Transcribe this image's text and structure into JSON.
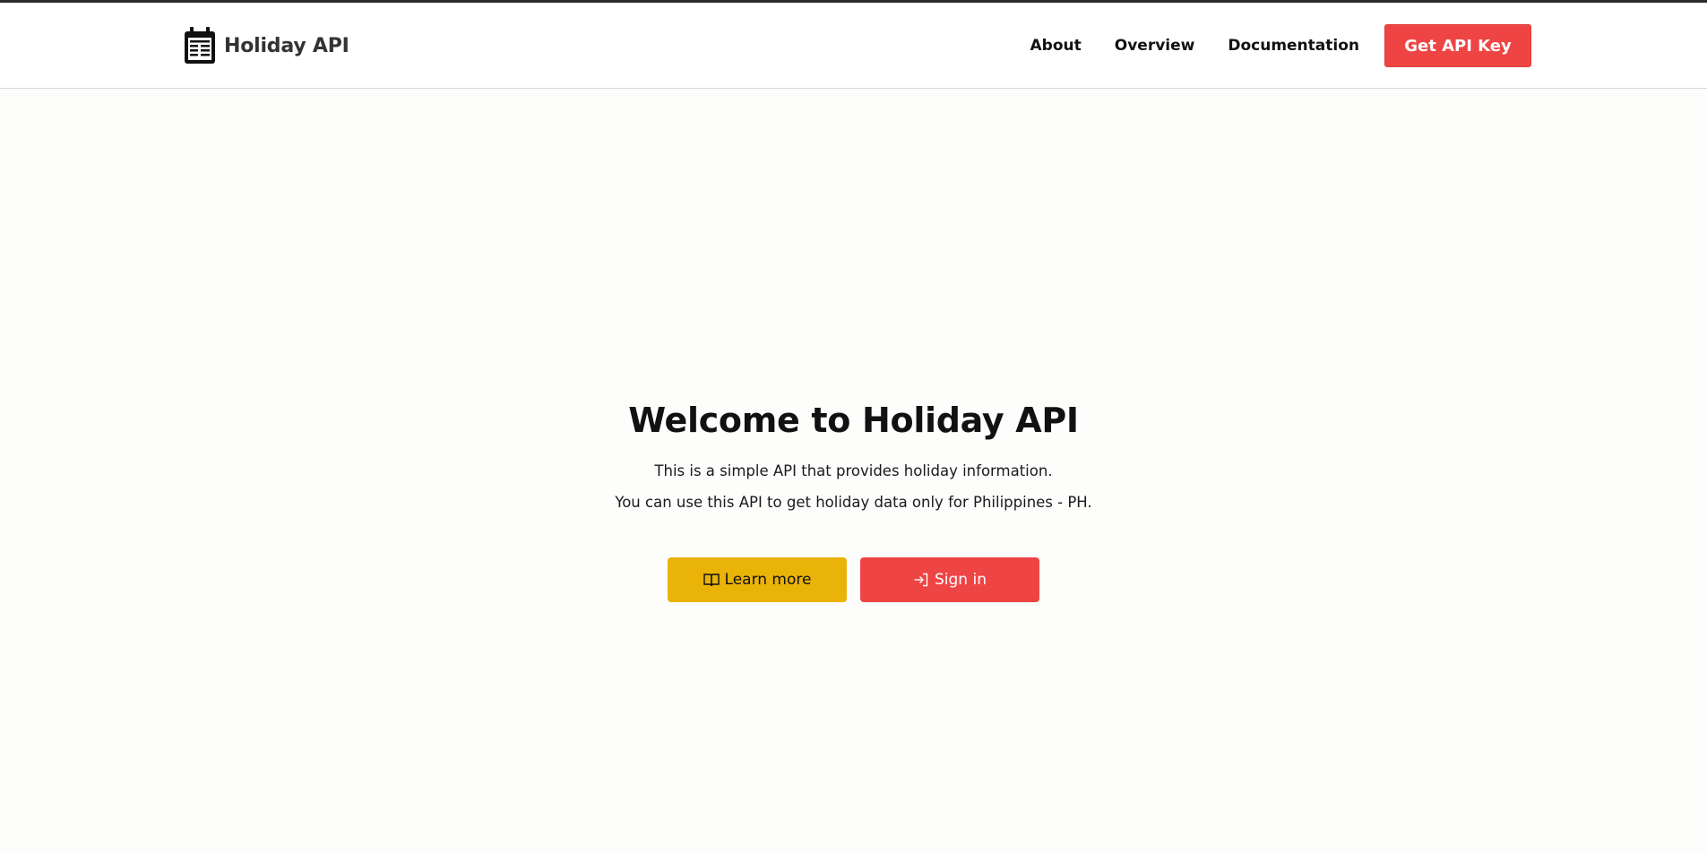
{
  "header": {
    "brand": "Holiday API",
    "logo_icon": "calendar-icon",
    "nav": [
      {
        "label": "About"
      },
      {
        "label": "Overview"
      },
      {
        "label": "Documentation"
      }
    ],
    "cta_label": "Get API Key"
  },
  "hero": {
    "title": "Welcome to Holiday API",
    "line1": "This is a simple API that provides holiday information.",
    "line2": "You can use this API to get holiday data only for Philippines - PH.",
    "learn_more": {
      "label": "Learn more",
      "icon": "book-open-icon"
    },
    "sign_in": {
      "label": "Sign in",
      "icon": "sign-in-icon"
    }
  },
  "colors": {
    "accent_red": "#ef4444",
    "accent_yellow": "#eab308",
    "background": "#fdfdfc"
  }
}
